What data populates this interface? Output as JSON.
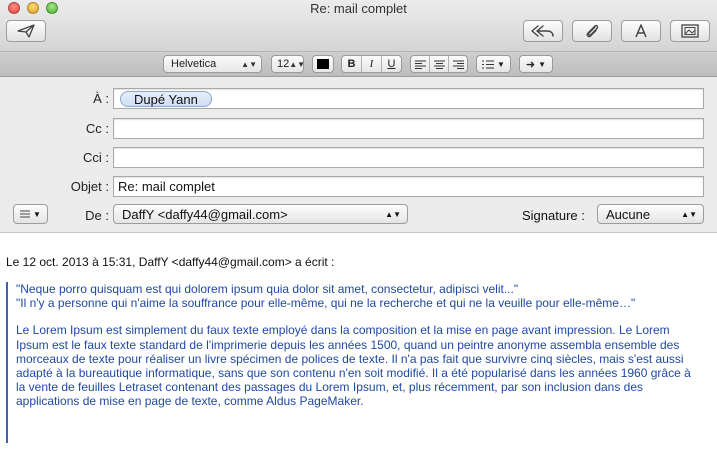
{
  "window": {
    "title": "Re: mail complet"
  },
  "toolbar": {
    "send": {
      "icon": "paper-plane-icon"
    },
    "reply_all": {
      "icon": "reply-all-icon"
    },
    "attach": {
      "icon": "paperclip-icon"
    },
    "fonts": {
      "icon": "font-A-icon"
    },
    "photo": {
      "icon": "photo-browser-icon"
    }
  },
  "formatbar": {
    "font_family": "Helvetica",
    "font_size": "12",
    "bold": "B",
    "italic": "I",
    "underline": "U"
  },
  "fields": {
    "to_label": "À :",
    "to_recipient": "Dupé Yann",
    "cc_label": "Cc :",
    "cc_value": "",
    "bcc_label": "Cci :",
    "bcc_value": "",
    "subject_label": "Objet :",
    "subject_value": "Re: mail complet",
    "from_label": "De :",
    "from_value": "DaffY <daffy44@gmail.com>",
    "signature_label": "Signature :",
    "signature_value": "Aucune"
  },
  "message": {
    "intro": "Le 12 oct. 2013 à 15:31, DaffY <daffy44@gmail.com> a écrit :",
    "quote_line1": "\"Neque porro quisquam est qui dolorem ipsum quia dolor sit amet, consectetur, adipisci velit...\"",
    "quote_line2": "\"Il n'y a personne qui n'aime la souffrance pour elle-même, qui ne la recherche et qui ne la veuille pour elle-même…\"",
    "para_lines": [
      "Le Lorem Ipsum est simplement du faux texte employé dans la composition et la mise en page avant impression. Le Lorem",
      "Ipsum est le faux texte standard de l'imprimerie depuis les années 1500, quand un peintre anonyme assembla ensemble des",
      "morceaux de texte pour réaliser un livre spécimen de polices de texte. Il n'a pas fait que survivre cinq siècles, mais s'est aussi",
      "adapté à la bureautique informatique, sans que son contenu n'en soit modifié. Il a été popularisé dans les années 1960 grâce à",
      "la vente de feuilles Letraset contenant des passages du Lorem Ipsum, et, plus récemment, par son inclusion dans des",
      "applications de mise en page de texte, comme Aldus PageMaker."
    ]
  },
  "colors": {
    "quote_text": "#2049a3",
    "quote_bar": "#3b63b0",
    "token_bg": "#cfdcf3"
  }
}
